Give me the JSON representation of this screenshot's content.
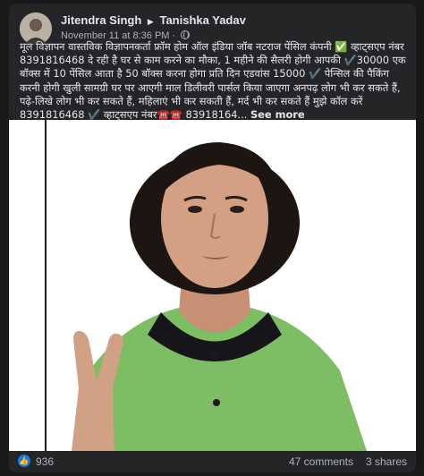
{
  "post": {
    "author": "Jitendra Singh",
    "recipient": "Tanishka Yadav",
    "timestamp": "November 11 at 8:36 PM",
    "privacy_dot": "·",
    "text": "मूल विज्ञापन वास्तविक विज्ञापनकर्ता फ्रॉम होम ऑल इंडिया जॉब नटराज पेंसिल कंपनी ✅ व्हाट्सएप नंबर 8391816468 दे रही है घर से काम करने का मौका, 1 महीने की सैलरी होगी आपकी ✔️30000 एक बॉक्स में 10 पेंसिल आता है 50 बॉक्स करना होगा प्रति दिन एडवांस 15000 ✔️ पेन्सिल की पैकिंग करनी होगी खुली सामग्री घर पर आएगी माल डिलीवरी पार्सल किया जाएगा अनपढ़ लोग भी कर सकते हैं, पढ़े-लिखे लोग भी कर सकते हैं, महिलाएं भी कर सकती हैं, मर्द भी कर सकते हैं मुझे कॉल करें 8391816468 ✔️ व्हाट्सएप नंबर☎️☎️ 83918164...",
    "see_more": "See more"
  },
  "reactions": {
    "like_icon": "like-icon",
    "like_count": "936",
    "comments": "47 comments",
    "shares": "3 shares"
  },
  "colors": {
    "background": "#18191a",
    "card": "#242526",
    "text_primary": "#e4e6eb",
    "text_secondary": "#b0b3b8",
    "like_blue": "#1877f2",
    "shirt_green": "#7dbd63",
    "collar": "#16161a"
  }
}
